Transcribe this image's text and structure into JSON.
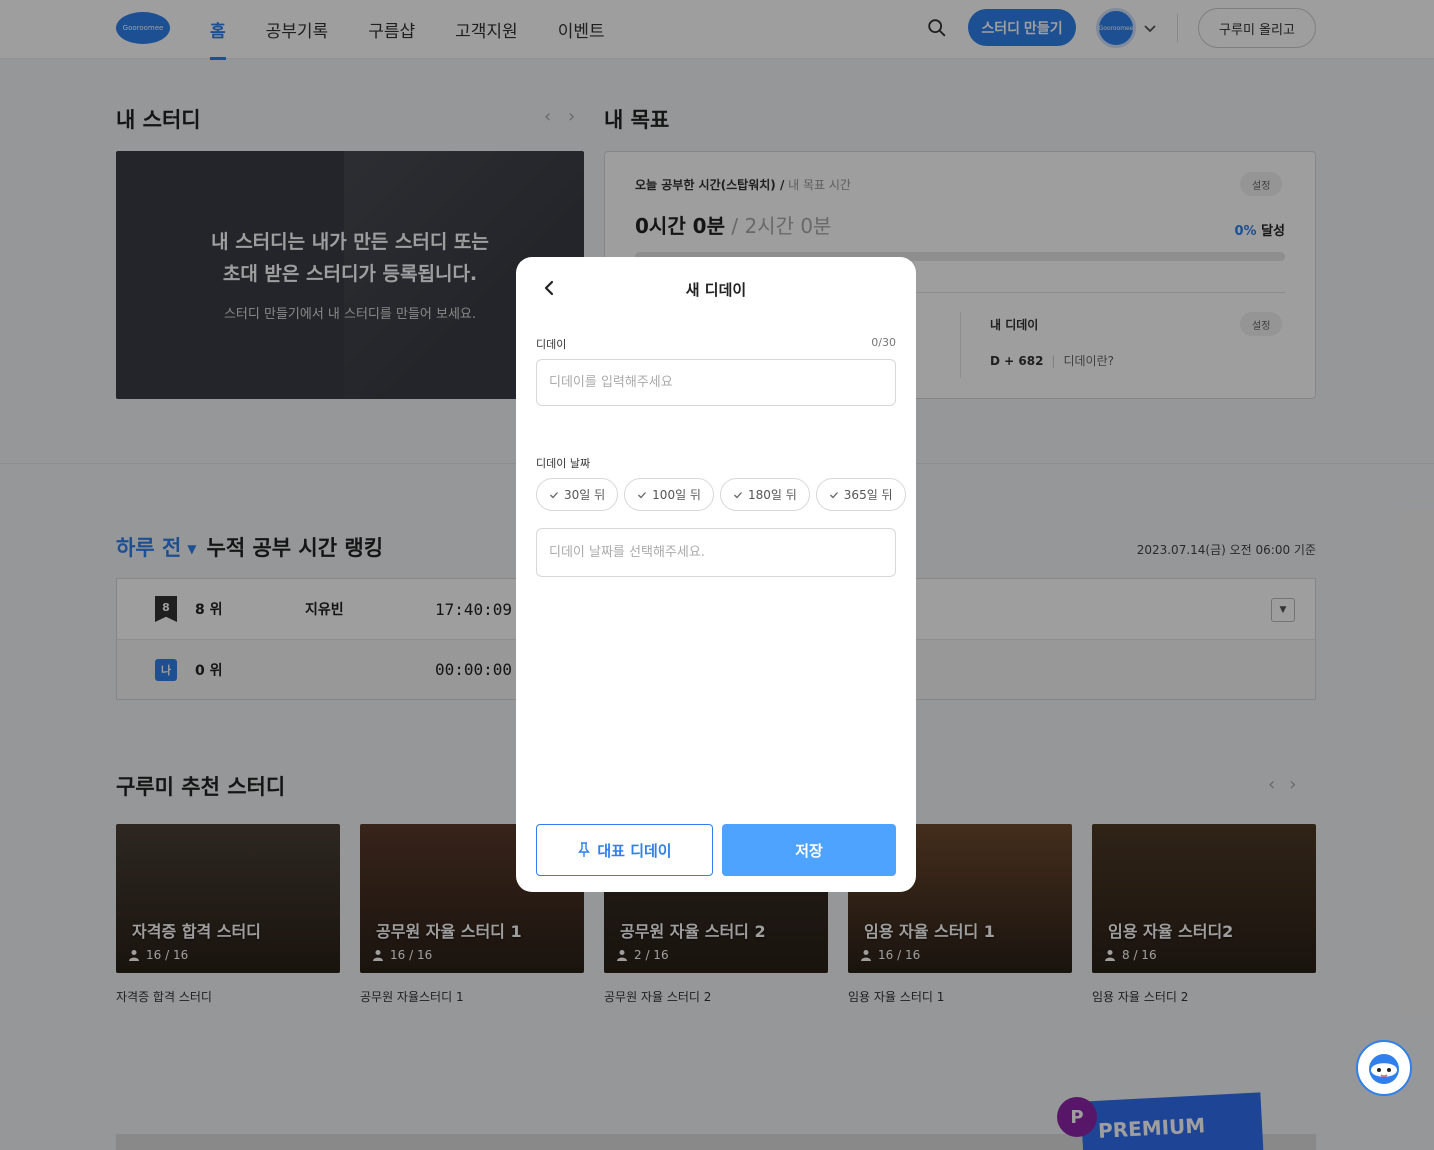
{
  "header": {
    "logo_text": "Gooroomee",
    "nav": [
      {
        "label": "홈",
        "active": true
      },
      {
        "label": "공부기록",
        "active": false
      },
      {
        "label": "구름샵",
        "active": false
      },
      {
        "label": "고객지원",
        "active": false
      },
      {
        "label": "이벤트",
        "active": false
      }
    ],
    "create_study_label": "스터디 만들기",
    "avatar_text": "Gooroomee",
    "upload_label": "구루미 올리고"
  },
  "my_study": {
    "title": "내 스터디",
    "empty_line1": "내 스터디는 내가 만든 스터디 또는",
    "empty_line2": "초대 받은 스터디가 등록됩니다.",
    "empty_sub": "스터디 만들기에서 내 스터디를 만들어 보세요."
  },
  "my_goal": {
    "title": "내 목표",
    "label_main": "오늘 공부한 시간(스탑워치) /",
    "label_sub": " 내 목표 시간",
    "settings_label": "설정",
    "studied": "0시간 0분",
    "target": " / 2시간 0분",
    "rate_pct": "0%",
    "rate_suffix": " 달성",
    "progress": 0,
    "dday_title": "내 디데이",
    "dday_settings_label": "설정",
    "dday_value": "D + 682",
    "dday_link": "디데이란?"
  },
  "ranking": {
    "period": "하루 전",
    "title": "누적 공부 시간 랭킹",
    "date": "2023.07.14(금) 오전 06:00 기준",
    "rows": [
      {
        "badge": "8",
        "rank": "8 위",
        "name": "지유빈",
        "time": "17:40:09"
      },
      {
        "badge": "나",
        "rank": "0 위",
        "name": "",
        "time": "00:00:00"
      }
    ]
  },
  "recommended": {
    "title": "구루미 추천 스터디",
    "studies": [
      {
        "title": "자격증 합격 스터디",
        "count": "16 / 16",
        "caption": "자격증 합격 스터디",
        "color": "#4a4036"
      },
      {
        "title": "공무원 자율 스터디 1",
        "count": "16 / 16",
        "caption": "공무원 자율스터디 1",
        "color": "#5a3a2a"
      },
      {
        "title": "공무원 자율 스터디 2",
        "count": "2 / 16",
        "caption": "공무원 자율 스터디 2",
        "color": "#3a3028"
      },
      {
        "title": "임용 자율 스터디 1",
        "count": "16 / 16",
        "caption": "임용 자율 스터디 1",
        "color": "#6e4a2e"
      },
      {
        "title": "임용 자율 스터디2",
        "count": "8 / 16",
        "caption": "임용 자율 스터디 2",
        "color": "#4e3a26"
      }
    ]
  },
  "premium": {
    "badge": "P",
    "label": "PREMIUM"
  },
  "modal": {
    "title": "새 디데이",
    "dday_label": "디데이",
    "dday_count": "0/30",
    "dday_placeholder": "디데이를 입력해주세요",
    "date_label": "디데이 날짜",
    "chips": [
      "30일 뒤",
      "100일 뒤",
      "180일 뒤",
      "365일 뒤"
    ],
    "date_placeholder": "디데이 날짜를 선택해주세요.",
    "rep_label": "대표 디데이",
    "save_label": "저장"
  },
  "colors": {
    "accent": "#2f80ed",
    "save_button": "#4da3ff",
    "premium_purple": "#8e24aa"
  }
}
